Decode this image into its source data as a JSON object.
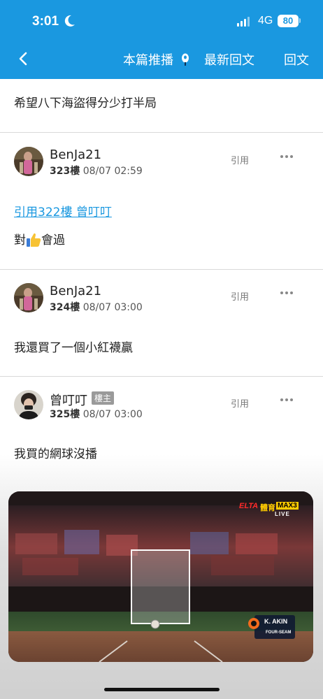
{
  "status_bar": {
    "time": "3:01",
    "network": "4G",
    "battery": "80"
  },
  "nav": {
    "push_label": "本篇推播",
    "latest_label": "最新回文",
    "reply_label": "回文"
  },
  "top_post": {
    "text": "希望八下海盜得分少打半局"
  },
  "posts": [
    {
      "username": "BenJa21",
      "floor": "323樓",
      "time": "08/07 02:59",
      "quote_label": "引用",
      "quote_link": "引用322樓 曾叮叮",
      "text_before_icon": "對",
      "text_after_icon": "會過"
    },
    {
      "username": "BenJa21",
      "floor": "324樓",
      "time": "08/07 03:00",
      "quote_label": "引用",
      "text": "我還買了一個小紅襪贏"
    },
    {
      "username": "曾叮叮",
      "badge": "樓主",
      "floor": "325樓",
      "time": "08/07 03:00",
      "quote_label": "引用",
      "text": "我買的網球沒播"
    }
  ],
  "video": {
    "logo_a": "ELTA",
    "logo_b": "體育",
    "logo_c": "MAX3",
    "live": "LIVE",
    "pitcher_name": "K. AKIN",
    "pitch_type": "FOUR-SEAM"
  },
  "colors": {
    "header": "#1a98e0",
    "link": "#1a98e0",
    "badge": "#9a9a9a"
  }
}
